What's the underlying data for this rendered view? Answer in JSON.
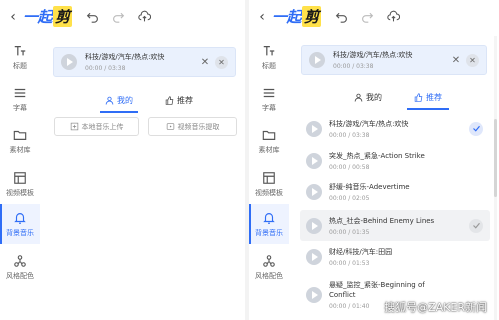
{
  "app": {
    "logo_main": "一起",
    "logo_accent": "剪"
  },
  "sidebar": {
    "items": [
      {
        "label": "标题",
        "icon": "text-icon"
      },
      {
        "label": "字幕",
        "icon": "subtitle-icon"
      },
      {
        "label": "素材库",
        "icon": "folder-icon"
      },
      {
        "label": "视频模板",
        "icon": "template-icon"
      },
      {
        "label": "背景音乐",
        "icon": "bell-icon"
      },
      {
        "label": "风格配色",
        "icon": "style-icon"
      }
    ],
    "active_index": 4
  },
  "current_track": {
    "name": "科技/游戏/汽车/热点:欢快",
    "time": "00:00 / 03:38"
  },
  "tabs": {
    "mine": "我的",
    "recommend": "推荐"
  },
  "left_panel": {
    "active_tab": "mine",
    "upload_label": "本地音乐上传",
    "extract_label": "视频音乐提取"
  },
  "right_panel": {
    "active_tab": "recommend",
    "tracks": [
      {
        "name": "科技/游戏/汽车/热点:欢快",
        "time": "00:00 / 03:38",
        "check": "blue"
      },
      {
        "name": "突发_热点_紧急-Action Strike",
        "time": "00:00 / 00:58",
        "check": ""
      },
      {
        "name": "舒缓-纯音乐-Adevertime",
        "time": "00:00 / 02:05",
        "check": ""
      },
      {
        "name": "热点_社会-Behind Enemy Lines",
        "time": "00:00 / 01:35",
        "check": "grey"
      },
      {
        "name": "财经/科技/汽车:田园",
        "time": "00:00 / 01:53",
        "check": ""
      },
      {
        "name": "悬疑_监控_紧张-Beginning of Conflict",
        "time": "00:00 / 01:40",
        "check": ""
      }
    ]
  },
  "watermark": "搜狐号@ZAKER新闻",
  "colors": {
    "accent": "#2f6df6",
    "logo_highlight": "#ffe14a",
    "active_bg": "#eef3ff"
  }
}
